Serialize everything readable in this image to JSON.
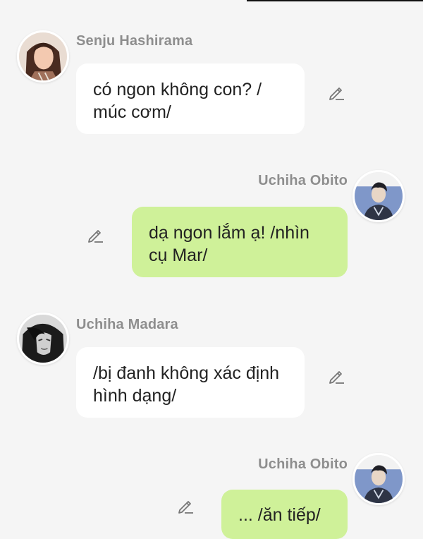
{
  "messages": [
    {
      "sender": "Senju Hashirama",
      "side": "left",
      "text": "có ngon không con? / múc cơm/",
      "avatar": "hashirama-avatar"
    },
    {
      "sender": "Uchiha Obito",
      "side": "right",
      "text": "dạ ngon lắm ạ! /nhìn cụ Mar/",
      "avatar": "obito-avatar"
    },
    {
      "sender": "Uchiha Madara",
      "side": "left",
      "text": "/bị đanh không xác định hình dạng/",
      "avatar": "madara-avatar"
    },
    {
      "sender": "Uchiha Obito",
      "side": "right",
      "text": "... /ăn tiếp/",
      "avatar": "obito-avatar"
    }
  ],
  "icons": {
    "edit": "pencil-edit-icon"
  },
  "colors": {
    "background": "#f5f5f5",
    "left_bubble": "#ffffff",
    "right_bubble": "#cff199",
    "name_text": "#8e8e8e"
  }
}
